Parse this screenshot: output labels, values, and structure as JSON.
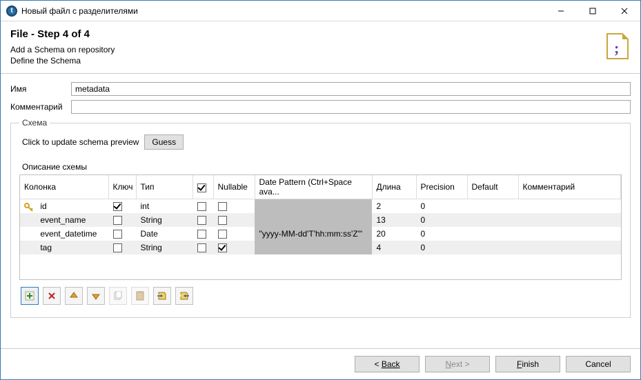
{
  "window": {
    "title": "Новый файл с разделителями"
  },
  "header": {
    "title": "File - Step 4 of 4",
    "line1": "Add a Schema on repository",
    "line2": "Define the Schema"
  },
  "form": {
    "name_label": "Имя",
    "name_value": "metadata",
    "comment_label": "Комментарий",
    "comment_value": ""
  },
  "schema_group": {
    "legend": "Схема",
    "guess_hint": "Click to update schema preview",
    "guess_button": "Guess",
    "desc_label": "Описание схемы",
    "columns": {
      "col": "Колонка",
      "key": "Ключ",
      "type": "Тип",
      "header_check": true,
      "nullable": "Nullable",
      "pattern": "Date Pattern (Ctrl+Space ava...",
      "length": "Длина",
      "precision": "Precision",
      "default": "Default",
      "comment": "Комментарий"
    },
    "rows": [
      {
        "name": "id",
        "key": true,
        "type": "int",
        "nullable": false,
        "pattern": "",
        "length": "2",
        "precision": "0",
        "default": "",
        "comment": "",
        "hasKeyIcon": true
      },
      {
        "name": "event_name",
        "key": false,
        "type": "String",
        "nullable": false,
        "pattern": "",
        "length": "13",
        "precision": "0",
        "default": "",
        "comment": "",
        "hasKeyIcon": false
      },
      {
        "name": "event_datetime",
        "key": false,
        "type": "Date",
        "nullable": false,
        "pattern": "\"yyyy-MM-dd'T'hh:mm:ss'Z'\"",
        "length": "20",
        "precision": "0",
        "default": "",
        "comment": "",
        "hasKeyIcon": false
      },
      {
        "name": "tag",
        "key": false,
        "type": "String",
        "nullable": true,
        "pattern": "",
        "length": "4",
        "precision": "0",
        "default": "",
        "comment": "",
        "hasKeyIcon": false
      }
    ]
  },
  "footer": {
    "back": "Back",
    "next": "Next >",
    "finish": "Finish",
    "cancel": "Cancel"
  }
}
